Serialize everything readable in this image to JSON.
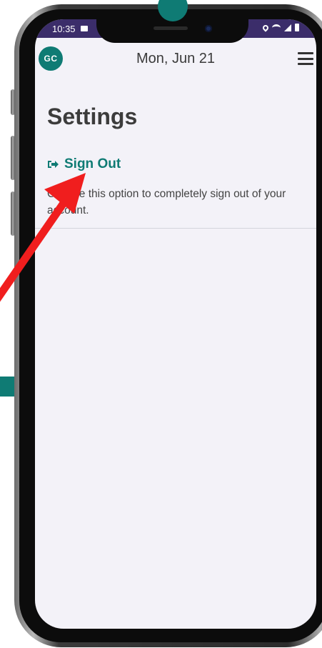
{
  "status_bar": {
    "time": "10:35"
  },
  "header": {
    "avatar_initials": "GC",
    "date": "Mon, Jun 21",
    "menu_icon": "hamburger-menu-icon"
  },
  "page": {
    "title": "Settings"
  },
  "sign_out": {
    "icon": "sign-out-icon",
    "label": "Sign Out",
    "description": "Choose this option to completely sign out of your account."
  },
  "colors": {
    "accent": "#0f7b74",
    "status_bar": "#3b2d6a",
    "screen_background": "#f3f2f8",
    "annotation_arrow": "#f01e1e"
  }
}
